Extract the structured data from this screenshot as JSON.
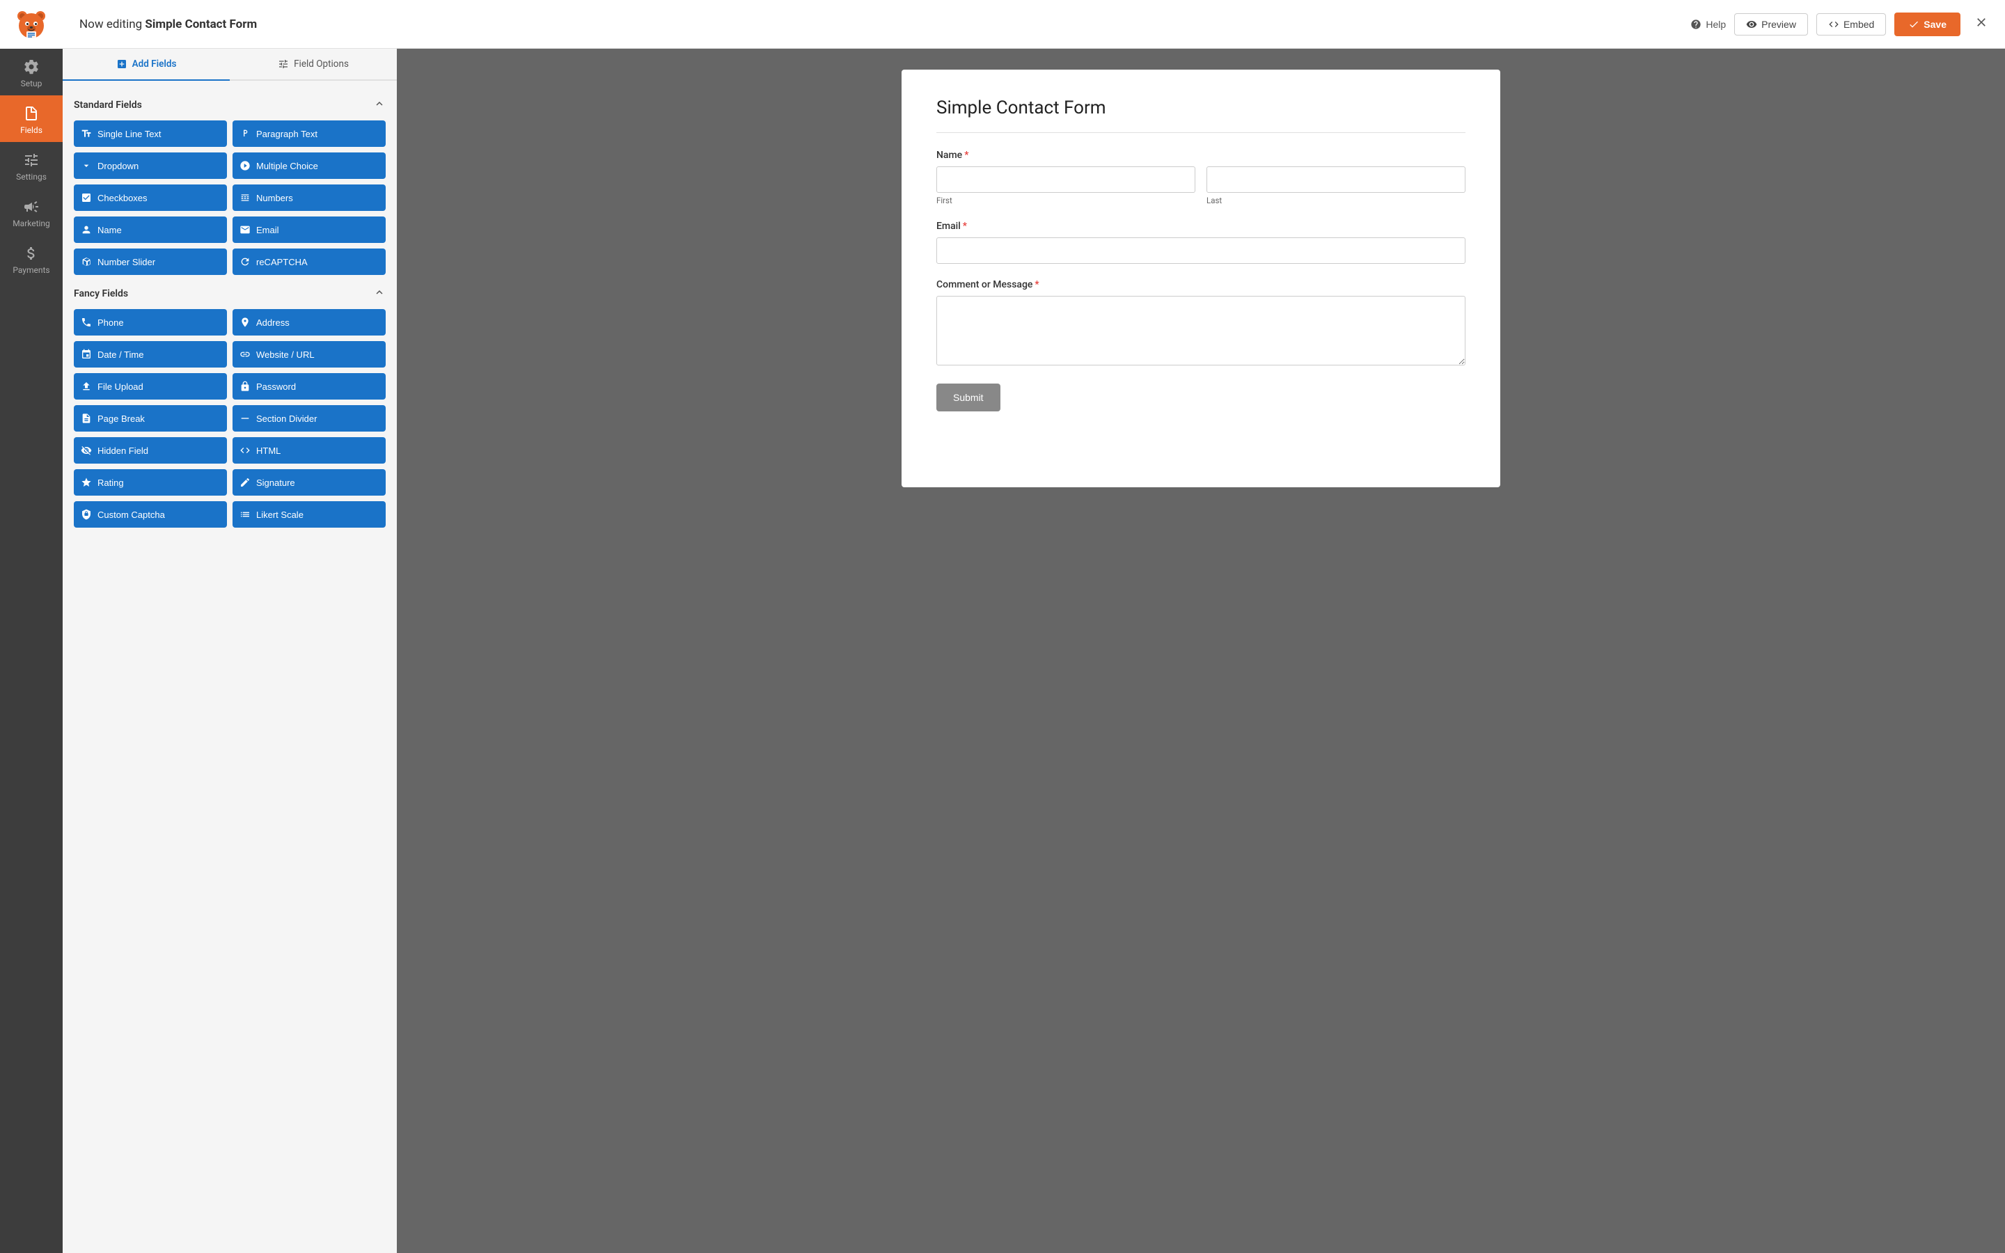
{
  "topbar": {
    "title_prefix": "Now editing ",
    "title_bold": "Simple Contact Form",
    "help_label": "Help",
    "preview_label": "Preview",
    "embed_label": "Embed",
    "save_label": "Save"
  },
  "sidebar": {
    "items": [
      {
        "id": "setup",
        "label": "Setup",
        "active": false
      },
      {
        "id": "fields",
        "label": "Fields",
        "active": true
      },
      {
        "id": "settings",
        "label": "Settings",
        "active": false
      },
      {
        "id": "marketing",
        "label": "Marketing",
        "active": false
      },
      {
        "id": "payments",
        "label": "Payments",
        "active": false
      }
    ]
  },
  "tabs": [
    {
      "id": "add-fields",
      "label": "Add Fields",
      "active": true
    },
    {
      "id": "field-options",
      "label": "Field Options",
      "active": false
    }
  ],
  "standard_fields": {
    "title": "Standard Fields",
    "items": [
      {
        "id": "single-line-text",
        "label": "Single Line Text",
        "icon": "text-icon"
      },
      {
        "id": "paragraph-text",
        "label": "Paragraph Text",
        "icon": "paragraph-icon"
      },
      {
        "id": "dropdown",
        "label": "Dropdown",
        "icon": "dropdown-icon"
      },
      {
        "id": "multiple-choice",
        "label": "Multiple Choice",
        "icon": "multiple-choice-icon"
      },
      {
        "id": "checkboxes",
        "label": "Checkboxes",
        "icon": "checkboxes-icon"
      },
      {
        "id": "numbers",
        "label": "Numbers",
        "icon": "numbers-icon"
      },
      {
        "id": "name",
        "label": "Name",
        "icon": "name-icon"
      },
      {
        "id": "email",
        "label": "Email",
        "icon": "email-icon"
      },
      {
        "id": "number-slider",
        "label": "Number Slider",
        "icon": "slider-icon"
      },
      {
        "id": "recaptcha",
        "label": "reCAPTCHA",
        "icon": "recaptcha-icon"
      }
    ]
  },
  "fancy_fields": {
    "title": "Fancy Fields",
    "items": [
      {
        "id": "phone",
        "label": "Phone",
        "icon": "phone-icon"
      },
      {
        "id": "address",
        "label": "Address",
        "icon": "address-icon"
      },
      {
        "id": "date-time",
        "label": "Date / Time",
        "icon": "date-icon"
      },
      {
        "id": "website-url",
        "label": "Website / URL",
        "icon": "url-icon"
      },
      {
        "id": "file-upload",
        "label": "File Upload",
        "icon": "upload-icon"
      },
      {
        "id": "password",
        "label": "Password",
        "icon": "password-icon"
      },
      {
        "id": "page-break",
        "label": "Page Break",
        "icon": "page-break-icon"
      },
      {
        "id": "section-divider",
        "label": "Section Divider",
        "icon": "divider-icon"
      },
      {
        "id": "hidden-field",
        "label": "Hidden Field",
        "icon": "hidden-icon"
      },
      {
        "id": "html",
        "label": "HTML",
        "icon": "html-icon"
      },
      {
        "id": "rating",
        "label": "Rating",
        "icon": "rating-icon"
      },
      {
        "id": "signature",
        "label": "Signature",
        "icon": "signature-icon"
      },
      {
        "id": "custom-captcha",
        "label": "Custom Captcha",
        "icon": "captcha-icon"
      },
      {
        "id": "likert-scale",
        "label": "Likert Scale",
        "icon": "likert-icon"
      }
    ]
  },
  "form": {
    "title": "Simple Contact Form",
    "fields": [
      {
        "id": "name",
        "label": "Name",
        "required": true,
        "type": "name",
        "sub_fields": [
          {
            "placeholder": "",
            "sub_label": "First"
          },
          {
            "placeholder": "",
            "sub_label": "Last"
          }
        ]
      },
      {
        "id": "email",
        "label": "Email",
        "required": true,
        "type": "email"
      },
      {
        "id": "comment",
        "label": "Comment or Message",
        "required": true,
        "type": "textarea"
      }
    ],
    "submit_label": "Submit"
  },
  "colors": {
    "accent_blue": "#1a73c8",
    "accent_orange": "#e8682a",
    "required_red": "#e53935"
  }
}
